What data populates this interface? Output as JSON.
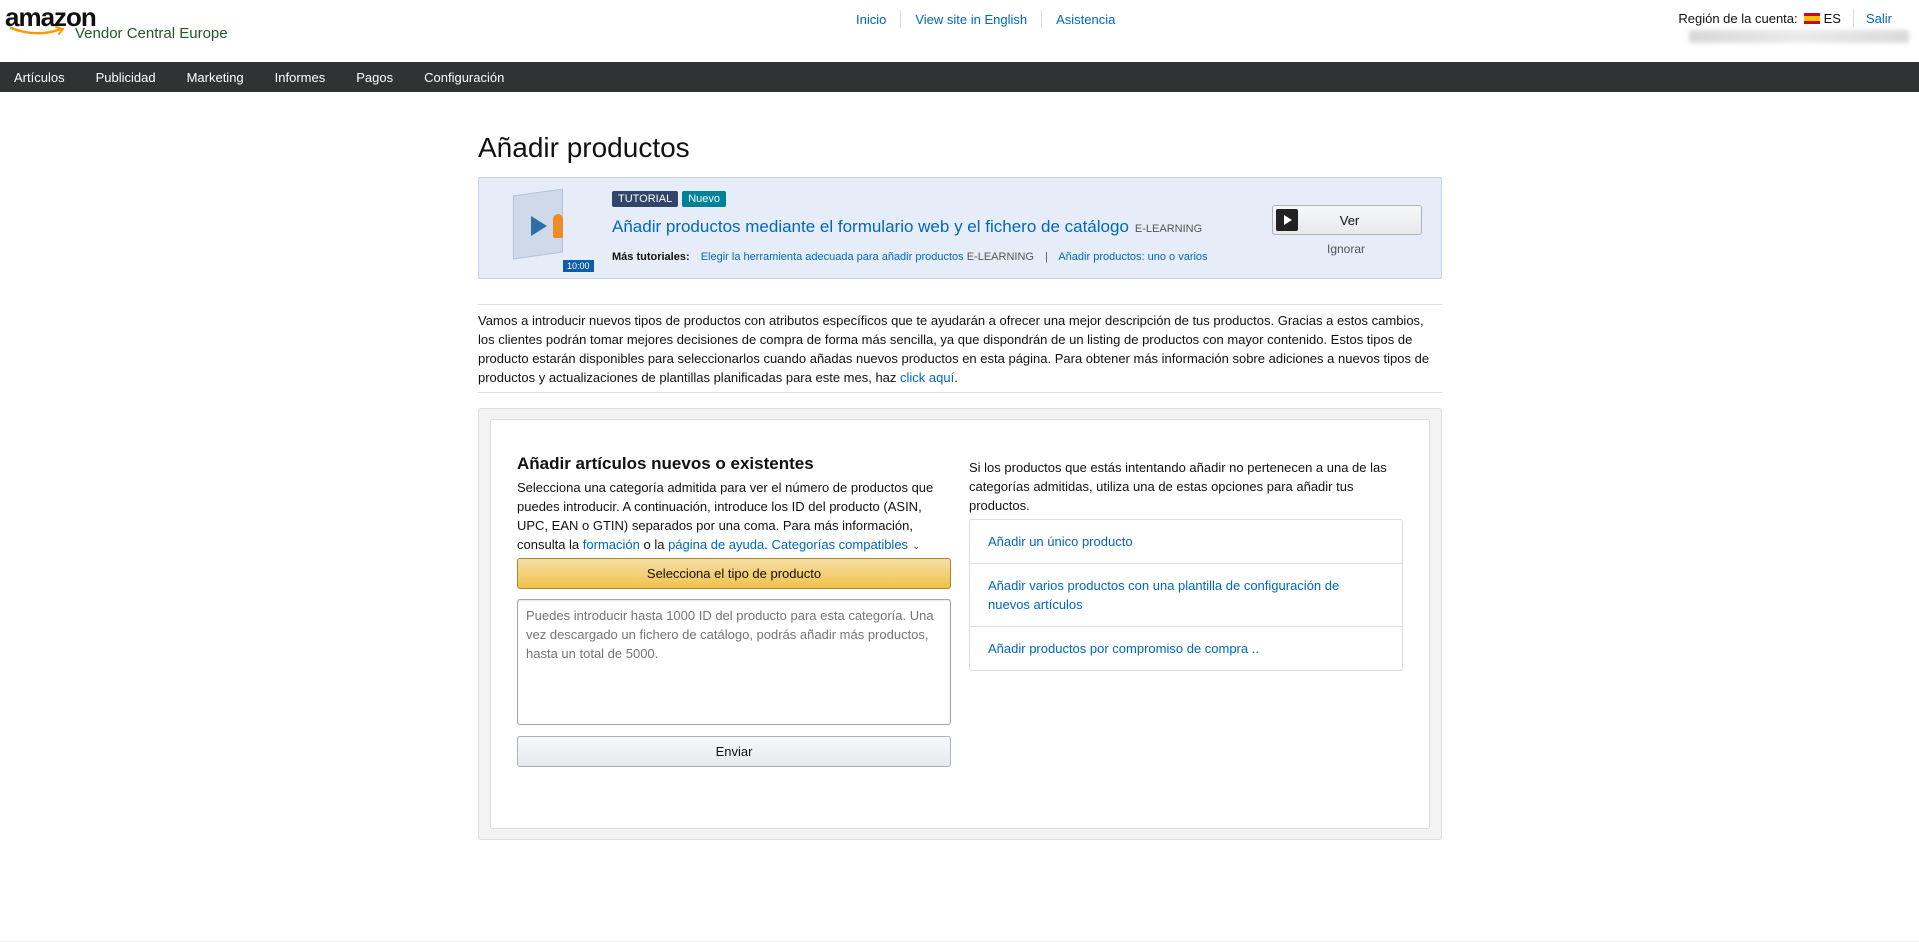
{
  "header": {
    "brand": "amazon",
    "subtitle": "Vendor Central Europe",
    "links": [
      "Inicio",
      "View site in English",
      "Asistencia"
    ],
    "region_label": "Región de la cuenta:",
    "region_code": "ES",
    "logout": "Salir"
  },
  "nav": {
    "items": [
      "Artículos",
      "Publicidad",
      "Marketing",
      "Informes",
      "Pagos",
      "Configuración"
    ]
  },
  "page": {
    "title": "Añadir productos"
  },
  "tutorial": {
    "badge_tutorial": "TUTORIAL",
    "badge_new": "Nuevo",
    "duration": "10:00",
    "title": "Añadir productos mediante el formulario web y el fichero de catálogo",
    "title_tag": "E-LEARNING",
    "more_label": "Más tutoriales:",
    "more_link_1": "Elegir la herramienta adecuada para añadir productos",
    "more_link_1_tag": "E-LEARNING",
    "more_sep": "|",
    "more_link_2": "Añadir productos: uno o varios",
    "watch_button": "Ver",
    "ignore": "Ignorar"
  },
  "intro": {
    "text": "Vamos a introducir nuevos tipos de productos con atributos específicos que te ayudarán a ofrecer una mejor descripción de tus productos. Gracias a estos cambios, los clientes podrán tomar mejores decisiones de compra de forma más sencilla, ya que dispondrán de un listing de productos con mayor contenido. Estos tipos de producto estarán disponibles para seleccionarlos cuando añadas nuevos productos en esta página. Para obtener más información sobre adiciones a nuevos tipos de productos y actualizaciones de plantillas planificadas para este mes, haz",
    "link": "click aquí",
    "end": "."
  },
  "add_items": {
    "heading": "Añadir artículos nuevos o existentes",
    "desc": "Selecciona una categoría admitida para ver el número de productos que puedes introducir. A continuación, introduce los ID del producto (ASIN, UPC, EAN o GTIN) separados por una coma. Para más información, consulta la",
    "link_training": "formación",
    "or": "o la",
    "link_help": "página de ayuda",
    "period": ".",
    "link_categories": "Categorías compatibles",
    "select_button": "Selecciona el tipo de producto",
    "textarea_placeholder": "Puedes introducir hasta 1000 ID del producto para esta categoría. Una vez descargado un fichero de catálogo, podrás añadir más productos, hasta un total de 5000.",
    "send_button": "Enviar"
  },
  "alternatives": {
    "text": "Si los productos que estás intentando añadir no pertenecen a una de las categorías admitidas, utiliza una de estas opciones para añadir tus productos.",
    "options": [
      "Añadir un único producto",
      "Añadir varios productos con una plantilla de configuración de nuevos artículos",
      "Añadir productos por compromiso de compra .."
    ]
  },
  "colors": {
    "nav_bg": "#303333",
    "link": "#0066c0",
    "primary_button": "#f0c14b",
    "tutorial_bg": "#e7edf8"
  }
}
